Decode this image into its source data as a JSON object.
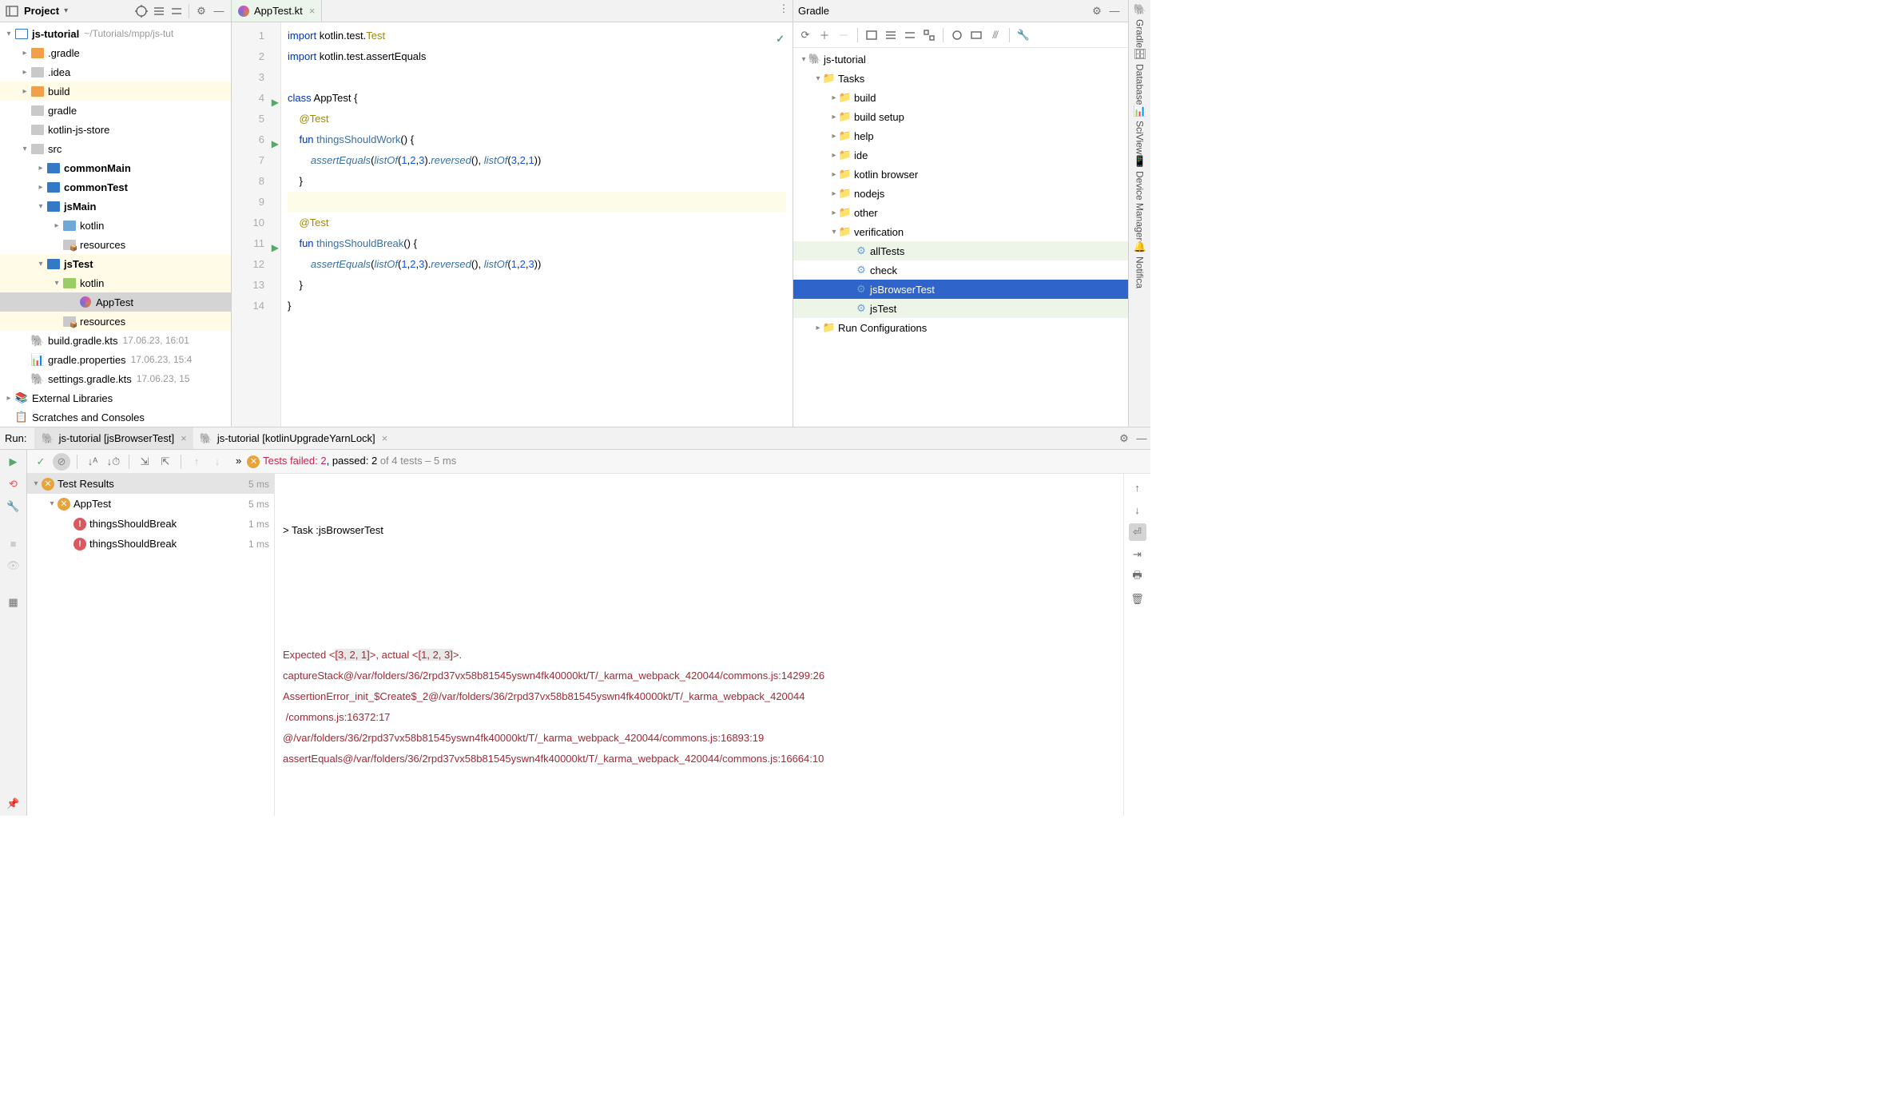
{
  "project": {
    "title": "Project",
    "root": {
      "name": "js-tutorial",
      "path": "~/Tutorials/mpp/js-tut"
    },
    "tree": [
      {
        "name": ".gradle",
        "type": "folder-orange",
        "depth": 1,
        "chev": ">"
      },
      {
        "name": ".idea",
        "type": "folder-gray",
        "depth": 1,
        "chev": ">"
      },
      {
        "name": "build",
        "type": "folder-orange",
        "depth": 1,
        "chev": ">",
        "hl": true
      },
      {
        "name": "gradle",
        "type": "folder-gray",
        "depth": 1,
        "chev": ""
      },
      {
        "name": "kotlin-js-store",
        "type": "folder-gray",
        "depth": 1,
        "chev": ""
      },
      {
        "name": "src",
        "type": "folder-gray",
        "depth": 1,
        "chev": "v"
      },
      {
        "name": "commonMain",
        "type": "folder-teal",
        "depth": 2,
        "chev": ">",
        "bold": true
      },
      {
        "name": "commonTest",
        "type": "folder-teal",
        "depth": 2,
        "chev": ">",
        "bold": true
      },
      {
        "name": "jsMain",
        "type": "folder-teal",
        "depth": 2,
        "chev": "v",
        "bold": true
      },
      {
        "name": "kotlin",
        "type": "folder-blue",
        "depth": 3,
        "chev": ">"
      },
      {
        "name": "resources",
        "type": "folder-res",
        "depth": 3,
        "chev": ""
      },
      {
        "name": "jsTest",
        "type": "folder-teal",
        "depth": 2,
        "chev": "v",
        "bold": true,
        "hl": true
      },
      {
        "name": "kotlin",
        "type": "folder-green",
        "depth": 3,
        "chev": "v",
        "hl": true
      },
      {
        "name": "AppTest",
        "type": "kotlin",
        "depth": 4,
        "chev": "",
        "selected": true
      },
      {
        "name": "resources",
        "type": "folder-res",
        "depth": 3,
        "chev": "",
        "hl": true
      },
      {
        "name": "build.gradle.kts",
        "type": "gradle-file",
        "depth": 1,
        "chev": "",
        "meta": "17.06.23, 16:01"
      },
      {
        "name": "gradle.properties",
        "type": "props-file",
        "depth": 1,
        "chev": "",
        "meta": "17.06.23, 15:4"
      },
      {
        "name": "settings.gradle.kts",
        "type": "gradle-file",
        "depth": 1,
        "chev": "",
        "meta": "17.06.23, 15"
      }
    ],
    "external_libraries": "External Libraries",
    "scratches": "Scratches and Consoles"
  },
  "editor": {
    "tab_name": "AppTest.kt",
    "lines": [
      {
        "n": 1,
        "html": "<span class='kw'>import</span> kotlin.test.<span class='ann'>Test</span>"
      },
      {
        "n": 2,
        "html": "<span class='kw'>import</span> kotlin.test.assertEquals"
      },
      {
        "n": 3,
        "html": ""
      },
      {
        "n": 4,
        "html": "<span class='kw'>class</span> AppTest {",
        "run": true
      },
      {
        "n": 5,
        "html": "    <span class='ann'>@Test</span>"
      },
      {
        "n": 6,
        "html": "    <span class='kw'>fun</span> <span class='fn'>thingsShouldWork</span>() {",
        "run": true
      },
      {
        "n": 7,
        "html": "        <span class='it'>assertEquals</span>(<span class='it'>listOf</span>(<span class='num'>1</span>,<span class='num'>2</span>,<span class='num'>3</span>).<span class='it'>reversed</span>(), <span class='it'>listOf</span>(<span class='num'>3</span>,<span class='num'>2</span>,<span class='num'>1</span>))"
      },
      {
        "n": 8,
        "html": "    }"
      },
      {
        "n": 9,
        "html": "",
        "hl": true
      },
      {
        "n": 10,
        "html": "    <span class='ann'>@Test</span>"
      },
      {
        "n": 11,
        "html": "    <span class='kw'>fun</span> <span class='fn'>thingsShouldBreak</span>() {",
        "run": true
      },
      {
        "n": 12,
        "html": "        <span class='it'>assertEquals</span>(<span class='it'>listOf</span>(<span class='num'>1</span>,<span class='num'>2</span>,<span class='num'>3</span>).<span class='it'>reversed</span>(), <span class='it'>listOf</span>(<span class='num'>1</span>,<span class='num'>2</span>,<span class='num'>3</span>))"
      },
      {
        "n": 13,
        "html": "    }"
      },
      {
        "n": 14,
        "html": "}"
      }
    ]
  },
  "gradle": {
    "title": "Gradle",
    "root": "js-tutorial",
    "tasks_label": "Tasks",
    "groups": [
      {
        "name": "build",
        "chev": ">"
      },
      {
        "name": "build setup",
        "chev": ">"
      },
      {
        "name": "help",
        "chev": ">"
      },
      {
        "name": "ide",
        "chev": ">"
      },
      {
        "name": "kotlin browser",
        "chev": ">"
      },
      {
        "name": "nodejs",
        "chev": ">"
      },
      {
        "name": "other",
        "chev": ">"
      },
      {
        "name": "verification",
        "chev": "v"
      }
    ],
    "verification_tasks": [
      {
        "name": "allTests",
        "hl": true
      },
      {
        "name": "check"
      },
      {
        "name": "jsBrowserTest",
        "selected": true
      },
      {
        "name": "jsTest",
        "hl": true
      }
    ],
    "run_config": "Run Configurations"
  },
  "right_rail": {
    "items": [
      "Gradle",
      "Database",
      "SciView",
      "Device Manager",
      "Notifica"
    ]
  },
  "run": {
    "label": "Run:",
    "tabs": [
      {
        "name": "js-tutorial [jsBrowserTest]",
        "active": true
      },
      {
        "name": "js-tutorial [kotlinUpgradeYarnLock]"
      }
    ],
    "status_failed": "Tests failed: 2",
    "status_passed": ", passed: 2",
    "status_rest": " of 4 tests – 5 ms",
    "tree": {
      "root": {
        "name": "Test Results",
        "dur": "5 ms"
      },
      "suite": {
        "name": "AppTest",
        "dur": "5 ms"
      },
      "tests": [
        {
          "name": "thingsShouldBreak",
          "dur": "1 ms"
        },
        {
          "name": "thingsShouldBreak",
          "dur": "1 ms"
        }
      ]
    },
    "console": {
      "task": "> Task :jsBrowserTest",
      "lines": [
        "Expected <[3, 2, 1]>, actual <[1, 2, 3]>.",
        "captureStack@/var/folders/36/2rpd37vx58b81545yswn4fk40000kt/T/_karma_webpack_420044/commons.js:14299:26",
        "AssertionError_init_$Create$_2@/var/folders/36/2rpd37vx58b81545yswn4fk40000kt/T/_karma_webpack_420044",
        " /commons.js:16372:17",
        "@/var/folders/36/2rpd37vx58b81545yswn4fk40000kt/T/_karma_webpack_420044/commons.js:16893:19",
        "assertEquals@/var/folders/36/2rpd37vx58b81545yswn4fk40000kt/T/_karma_webpack_420044/commons.js:16664:10"
      ]
    }
  }
}
